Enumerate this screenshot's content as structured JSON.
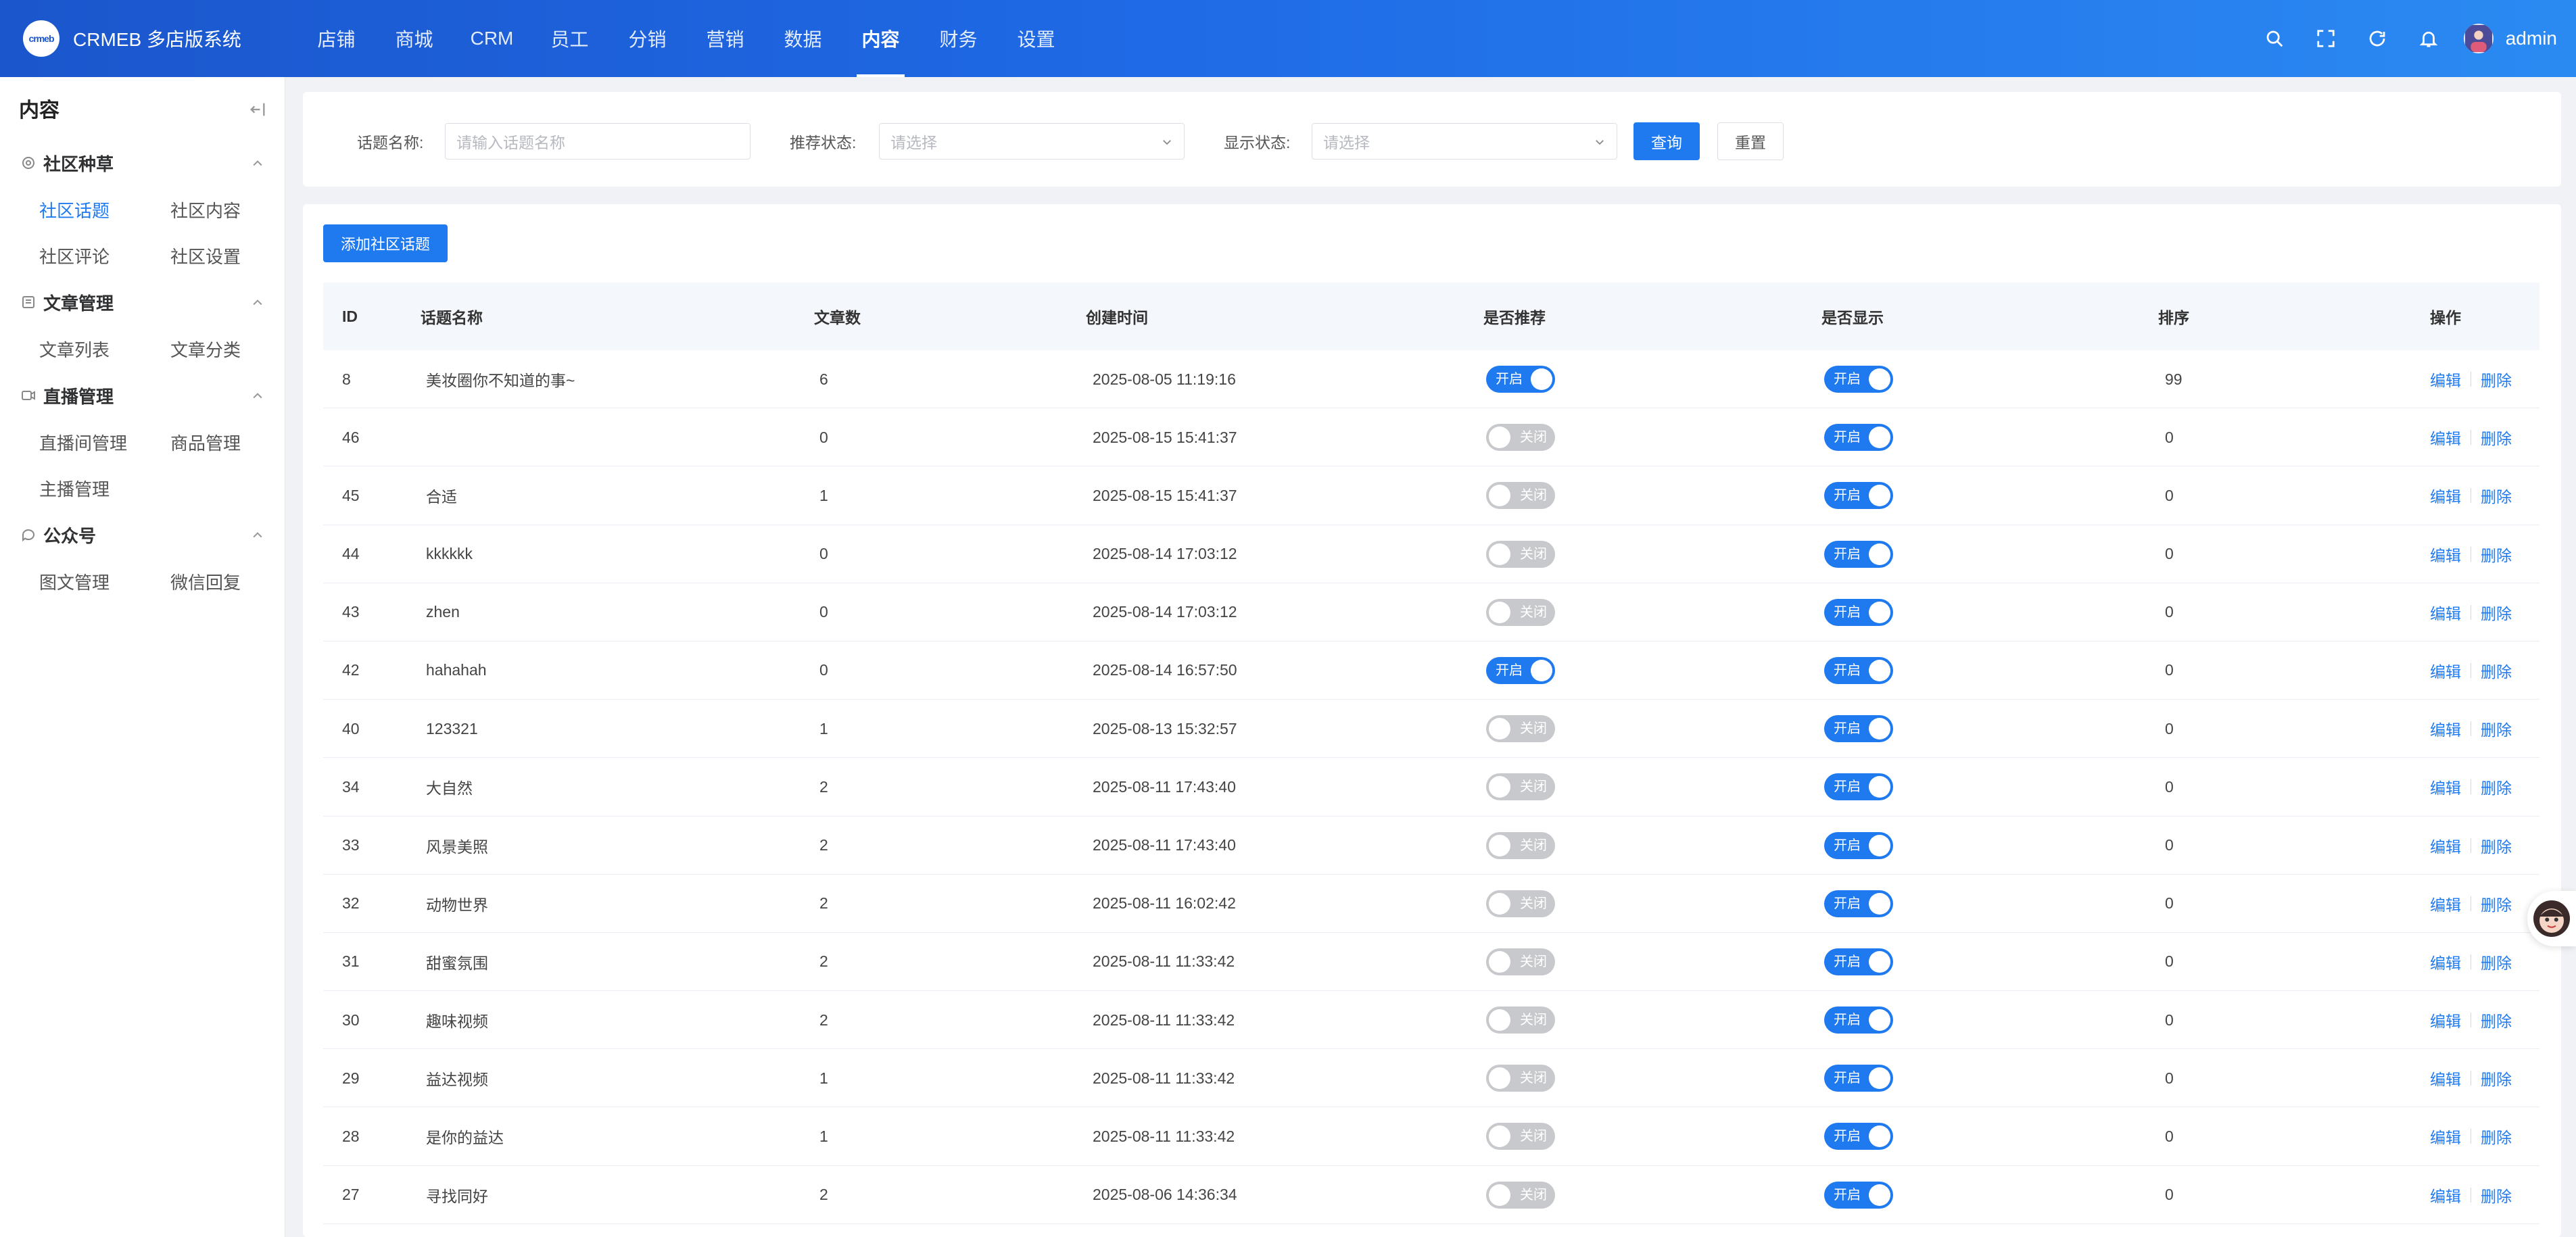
{
  "header": {
    "logo_text": "crmeb",
    "brand": "CRMEB 多店版系统",
    "nav": [
      "店铺",
      "商城",
      "CRM",
      "员工",
      "分销",
      "营销",
      "数据",
      "内容",
      "财务",
      "设置"
    ],
    "active_nav": "内容",
    "icons": [
      "search-icon",
      "fullscreen-icon",
      "refresh-icon",
      "bell-icon"
    ],
    "user": "admin"
  },
  "sidebar": {
    "title": "内容",
    "groups": [
      {
        "title": "社区种草",
        "icon": "community-icon",
        "items": [
          "社区话题",
          "社区内容",
          "社区评论",
          "社区设置"
        ]
      },
      {
        "title": "文章管理",
        "icon": "article-icon",
        "items": [
          "文章列表",
          "文章分类"
        ]
      },
      {
        "title": "直播管理",
        "icon": "video-icon",
        "items": [
          "直播间管理",
          "商品管理",
          "主播管理"
        ]
      },
      {
        "title": "公众号",
        "icon": "chat-icon",
        "items": [
          "图文管理",
          "微信回复"
        ]
      }
    ],
    "active_item": "社区话题"
  },
  "filters": {
    "name_label": "话题名称:",
    "name_placeholder": "请输入话题名称",
    "recommend_label": "推荐状态:",
    "recommend_placeholder": "请选择",
    "show_label": "显示状态:",
    "show_placeholder": "请选择",
    "query": "查询",
    "reset": "重置"
  },
  "add_button": "添加社区话题",
  "table": {
    "headers": [
      "ID",
      "话题名称",
      "文章数",
      "创建时间",
      "是否推荐",
      "是否显示",
      "排序",
      "操作"
    ],
    "switch_on": "开启",
    "switch_off": "关闭",
    "edit": "编辑",
    "delete": "删除",
    "rows": [
      {
        "id": "8",
        "name": "美妆圈你不知道的事~",
        "count": "6",
        "time": "2025-08-05 11:19:16",
        "recommend": true,
        "show": true,
        "sort": "99"
      },
      {
        "id": "46",
        "name": "",
        "count": "0",
        "time": "2025-08-15 15:41:37",
        "recommend": false,
        "show": true,
        "sort": "0"
      },
      {
        "id": "45",
        "name": "合适",
        "count": "1",
        "time": "2025-08-15 15:41:37",
        "recommend": false,
        "show": true,
        "sort": "0"
      },
      {
        "id": "44",
        "name": "kkkkkk",
        "count": "0",
        "time": "2025-08-14 17:03:12",
        "recommend": false,
        "show": true,
        "sort": "0"
      },
      {
        "id": "43",
        "name": "zhen",
        "count": "0",
        "time": "2025-08-14 17:03:12",
        "recommend": false,
        "show": true,
        "sort": "0"
      },
      {
        "id": "42",
        "name": "hahahah",
        "count": "0",
        "time": "2025-08-14 16:57:50",
        "recommend": true,
        "show": true,
        "sort": "0"
      },
      {
        "id": "40",
        "name": "123321",
        "count": "1",
        "time": "2025-08-13 15:32:57",
        "recommend": false,
        "show": true,
        "sort": "0"
      },
      {
        "id": "34",
        "name": "大自然",
        "count": "2",
        "time": "2025-08-11 17:43:40",
        "recommend": false,
        "show": true,
        "sort": "0"
      },
      {
        "id": "33",
        "name": "风景美照",
        "count": "2",
        "time": "2025-08-11 17:43:40",
        "recommend": false,
        "show": true,
        "sort": "0"
      },
      {
        "id": "32",
        "name": "动物世界",
        "count": "2",
        "time": "2025-08-11 16:02:42",
        "recommend": false,
        "show": true,
        "sort": "0"
      },
      {
        "id": "31",
        "name": "甜蜜氛围",
        "count": "2",
        "time": "2025-08-11 11:33:42",
        "recommend": false,
        "show": true,
        "sort": "0"
      },
      {
        "id": "30",
        "name": "趣味视频",
        "count": "2",
        "time": "2025-08-11 11:33:42",
        "recommend": false,
        "show": true,
        "sort": "0"
      },
      {
        "id": "29",
        "name": "益达视频",
        "count": "1",
        "time": "2025-08-11 11:33:42",
        "recommend": false,
        "show": true,
        "sort": "0"
      },
      {
        "id": "28",
        "name": "是你的益达",
        "count": "1",
        "time": "2025-08-11 11:33:42",
        "recommend": false,
        "show": true,
        "sort": "0"
      },
      {
        "id": "27",
        "name": "寻找同好",
        "count": "2",
        "time": "2025-08-06 14:36:34",
        "recommend": false,
        "show": true,
        "sort": "0"
      }
    ]
  },
  "colors": {
    "primary": "#1f7af0",
    "header_start": "#1b56cc",
    "header_end": "#2b8af2",
    "switch_off": "#c8c9cc"
  }
}
